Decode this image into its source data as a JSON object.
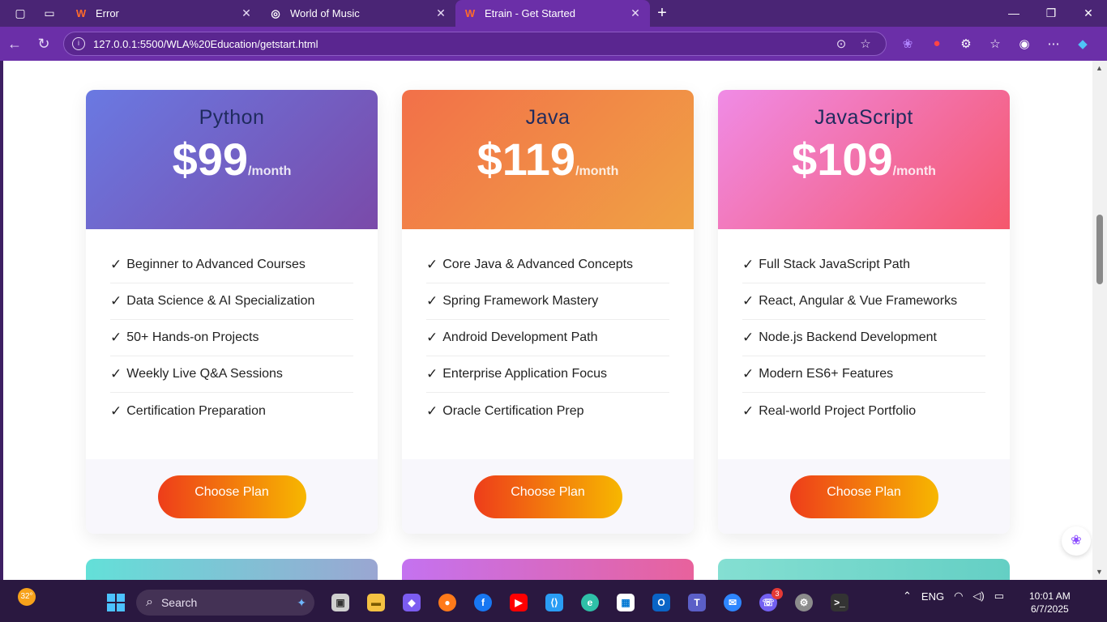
{
  "browser": {
    "tabs": [
      {
        "title": "Error",
        "favicon": "w-logo-icon"
      },
      {
        "title": "World of Music",
        "favicon": "globe-icon"
      },
      {
        "title": "Etrain - Get Started",
        "favicon": "w-logo-icon",
        "active": true
      }
    ],
    "url": "127.0.0.1:5500/WLA%20Education/getstart.html"
  },
  "plans": [
    {
      "name": "Python",
      "price": "$99",
      "period": "/month",
      "gradient": [
        "#6a79e2",
        "#7a4aa9"
      ],
      "features": [
        "Beginner to Advanced Courses",
        "Data Science & AI Specialization",
        "50+ Hands-on Projects",
        "Weekly Live Q&A Sessions",
        "Certification Preparation"
      ],
      "button": "Choose Plan"
    },
    {
      "name": "Java",
      "price": "$119",
      "period": "/month",
      "gradient": [
        "#f27049",
        "#f0a244"
      ],
      "features": [
        "Core Java & Advanced Concepts",
        "Spring Framework Mastery",
        "Android Development Path",
        "Enterprise Application Focus",
        "Oracle Certification Prep"
      ],
      "button": "Choose Plan"
    },
    {
      "name": "JavaScript",
      "price": "$109",
      "period": "/month",
      "gradient": [
        "#f08be6",
        "#f5576c"
      ],
      "features": [
        "Full Stack JavaScript Path",
        "React, Angular & Vue Frameworks",
        "Node.js Backend Development",
        "Modern ES6+ Features",
        "Real-world Project Portfolio"
      ],
      "button": "Choose Plan"
    }
  ],
  "next_row_gradients": [
    [
      "#63e0d8",
      "#9aa6d2"
    ],
    [
      "#c472f0",
      "#e8629c"
    ],
    [
      "#84dfd2",
      "#64cfc4"
    ]
  ],
  "taskbar": {
    "weather": "32°",
    "search": "Search",
    "viber_badge": "3",
    "lang": "ENG",
    "time": "10:01 AM",
    "date": "6/7/2025"
  }
}
